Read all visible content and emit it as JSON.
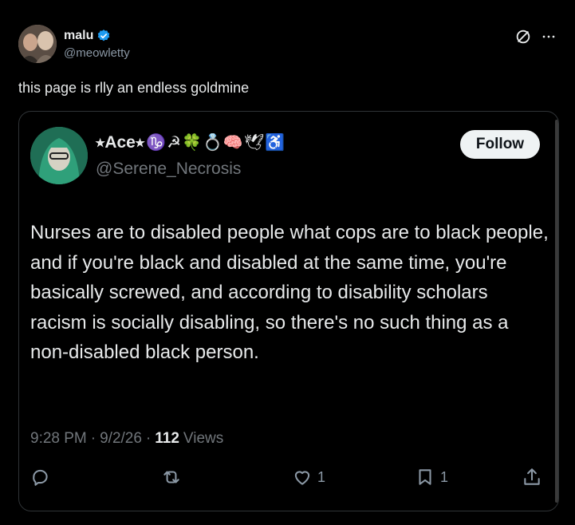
{
  "outer": {
    "name": "malu",
    "handle": "@meowletty",
    "text": "this page is rlly an endless goldmine",
    "icons": [
      "verified-icon",
      "grok-icon",
      "more-icon"
    ],
    "verified_color": "#1d9bf0"
  },
  "quoted": {
    "name": "⭒Ace⭒",
    "emojis": "♑☭🍀💍🧠🕊♿",
    "handle": "@Serene_Necrosis",
    "follow_label": "Follow",
    "body": "Nurses are to disabled people what cops are to black people, and if you're black and disabled at the same time, you're basically screwed, and according to disability scholars racism is socially disabling, so there's no such thing as a non-disabled black person.",
    "time": "9:28 PM",
    "date": "9/2/26",
    "sep": "·",
    "views_count": "112",
    "views_label": "Views",
    "likes": "1",
    "bookmarks": "1"
  }
}
